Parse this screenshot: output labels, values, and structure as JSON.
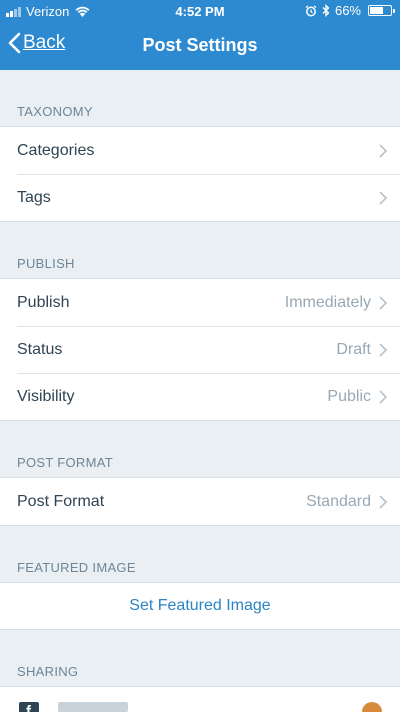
{
  "status_bar": {
    "carrier": "Verizon",
    "time": "4:52 PM",
    "battery": "66%",
    "battery_level": 0.66
  },
  "nav": {
    "back_label": "Back",
    "title": "Post Settings"
  },
  "sections": {
    "taxonomy": {
      "header": "TAXONOMY",
      "rows": [
        {
          "label": "Categories"
        },
        {
          "label": "Tags"
        }
      ]
    },
    "publish": {
      "header": "PUBLISH",
      "rows": [
        {
          "label": "Publish",
          "value": "Immediately"
        },
        {
          "label": "Status",
          "value": "Draft"
        },
        {
          "label": "Visibility",
          "value": "Public"
        }
      ]
    },
    "post_format": {
      "header": "POST FORMAT",
      "rows": [
        {
          "label": "Post Format",
          "value": "Standard"
        }
      ]
    },
    "featured_image": {
      "header": "FEATURED IMAGE",
      "action_label": "Set Featured Image"
    },
    "sharing": {
      "header": "SHARING"
    }
  },
  "colors": {
    "header_bg": "#2e8ad0",
    "page_bg": "#e9eff3",
    "link": "#2a85c6",
    "label": "#2e4453",
    "muted": "#98a8b4"
  },
  "icons": [
    "signal-icon",
    "wifi-icon",
    "alarm-icon",
    "bluetooth-icon",
    "battery-icon",
    "back-chevron-icon",
    "chevron-right-icon",
    "facebook-icon"
  ]
}
